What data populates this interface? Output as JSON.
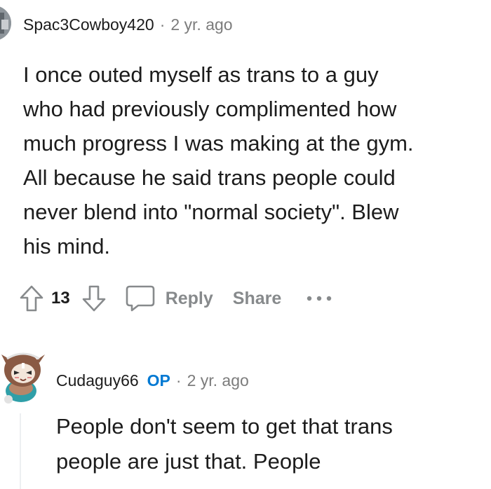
{
  "comment1": {
    "username": "Spac3Cowboy420",
    "separator": "·",
    "time": "2 yr. ago",
    "body_lines": [
      "I once outed myself as trans to a guy",
      "who had previously complimented how",
      "much progress I was making at the gym.",
      "All because he said trans people could",
      "never blend into \"normal society\". Blew",
      "his mind."
    ],
    "vote_count": "13",
    "reply_label": "Reply",
    "share_label": "Share",
    "icons": [
      "upvote-icon",
      "downvote-icon",
      "comment-bubble-icon",
      "more-options-icon"
    ]
  },
  "comment2": {
    "username": "Cudaguy66",
    "op_badge": "OP",
    "separator": "·",
    "time": "2 yr. ago",
    "body_lines": [
      "People don't seem to get that trans",
      "people are just that. People"
    ]
  },
  "colors": {
    "text": "#1c1c1c",
    "meta": "#7c7c7c",
    "action": "#878a8c",
    "op": "#0079d3",
    "thread_line": "#edeff1"
  }
}
